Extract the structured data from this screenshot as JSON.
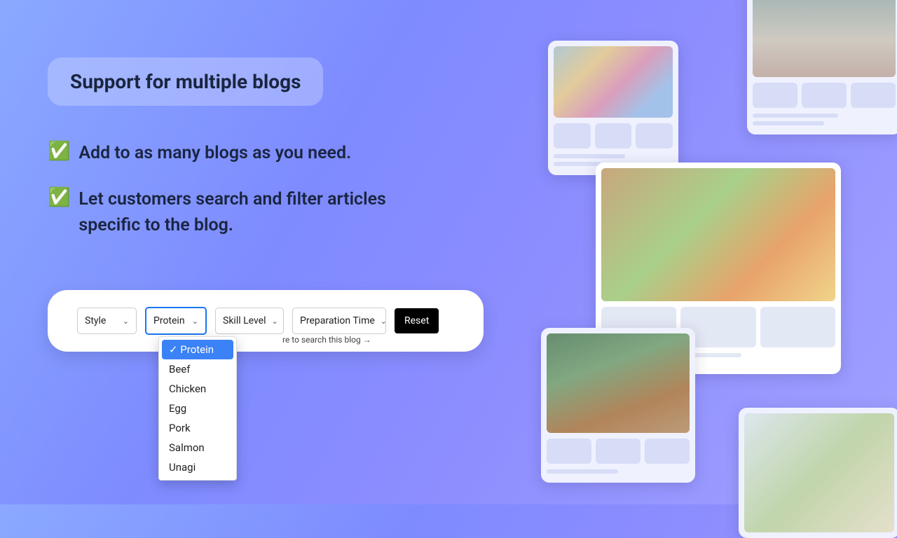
{
  "heading": "Support for multiple blogs",
  "bullets": [
    "Add to as many blogs as you need.",
    "Let customers search and filter articles specific to the blog."
  ],
  "filters": {
    "style": "Style",
    "protein": "Protein",
    "skill": "Skill Level",
    "prep": "Preparation Time",
    "reset": "Reset",
    "search_hint": "re to search this blog"
  },
  "dropdown": {
    "selected": "Protein",
    "items": [
      "Protein",
      "Beef",
      "Chicken",
      "Egg",
      "Pork",
      "Salmon",
      "Unagi"
    ]
  }
}
